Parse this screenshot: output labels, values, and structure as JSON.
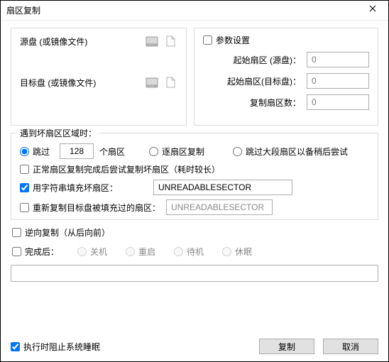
{
  "window": {
    "title": "扇区复制"
  },
  "source": {
    "src_label": "源盘 (或镜像文件)",
    "dst_label": "目标盘 (或镜像文件)"
  },
  "params": {
    "header": "参数设置",
    "start_src_label": "起始扇区 (源盘)：",
    "start_src_value": "0",
    "start_dst_label": "起始扇区(目标盘)：",
    "start_dst_value": "0",
    "count_label": "复制扇区数：",
    "count_value": "0"
  },
  "bad": {
    "legend": "遇到坏扇区区域时：",
    "skip_label": "跳过",
    "skip_value": "128",
    "skip_unit": "个扇区",
    "per_sector_label": "逐扇区复制",
    "jump_big_label": "跳过大段扇区以备稍后尝试",
    "retry_label": "正常扇区复制完成后尝试复制坏扇区（耗时较长）",
    "fill_label": "用字符串填充坏扇区：",
    "fill_value": "UNREADABLESECTOR",
    "refill_label": "重新复制目标盘被填充过的扇区：",
    "refill_value": "UNREADABLESECTOR"
  },
  "reverse_label": "逆向复制（从后向前）",
  "after": {
    "label": "完成后：",
    "shutdown": "关机",
    "reboot": "重启",
    "standby": "待机",
    "hibernate": "休眠"
  },
  "footer": {
    "prevent_sleep": "执行时阻止系统睡眠",
    "copy": "复制",
    "cancel": "取消"
  },
  "icons": {
    "disk": "disk-icon",
    "file": "file-icon",
    "close": "close-icon"
  }
}
